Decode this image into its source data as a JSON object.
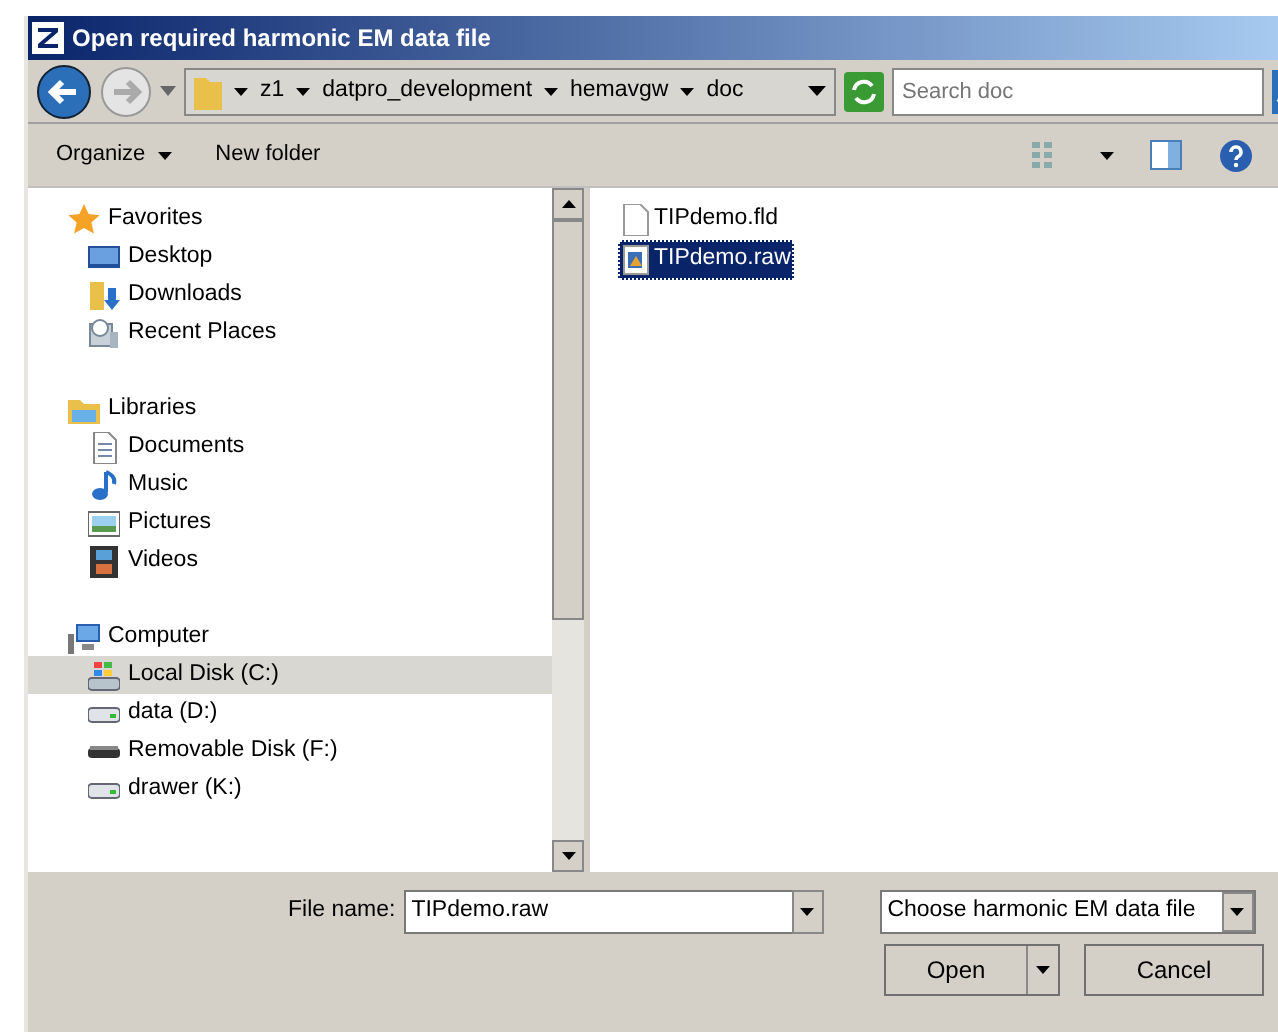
{
  "window": {
    "title": "Open required harmonic EM data file"
  },
  "address_bar": {
    "crumbs": [
      "z1",
      "datpro_development",
      "hemavgw",
      "doc"
    ]
  },
  "search": {
    "placeholder": "Search doc"
  },
  "toolbar": {
    "organize": "Organize",
    "new_folder": "New folder"
  },
  "navigation": [
    {
      "label": "Favorites",
      "kind": "star",
      "selected": false,
      "children": [
        {
          "label": "Desktop",
          "kind": "desktop",
          "selected": false
        },
        {
          "label": "Downloads",
          "kind": "download",
          "selected": false
        },
        {
          "label": "Recent Places",
          "kind": "recent",
          "selected": false
        }
      ]
    },
    {
      "label": "Libraries",
      "kind": "library",
      "selected": false,
      "children": [
        {
          "label": "Documents",
          "kind": "document",
          "selected": false
        },
        {
          "label": "Music",
          "kind": "music",
          "selected": false
        },
        {
          "label": "Pictures",
          "kind": "pictures",
          "selected": false
        },
        {
          "label": "Videos",
          "kind": "videos",
          "selected": false
        }
      ]
    },
    {
      "label": "Computer",
      "kind": "computer",
      "selected": false,
      "children": [
        {
          "label": "Local Disk (C:)",
          "kind": "systemdisk",
          "selected": true
        },
        {
          "label": "data (D:)",
          "kind": "disk",
          "selected": false
        },
        {
          "label": "Removable Disk (F:)",
          "kind": "removable",
          "selected": false
        },
        {
          "label": "drawer (K:)",
          "kind": "disk",
          "selected": false
        }
      ]
    }
  ],
  "files": [
    {
      "name": "TIPdemo.fld",
      "kind": "blank",
      "selected": false
    },
    {
      "name": "TIPdemo.raw",
      "kind": "data",
      "selected": true
    }
  ],
  "file_name": {
    "label": "File name:",
    "value": "TIPdemo.raw"
  },
  "file_type": {
    "value": "Choose harmonic EM data file"
  },
  "buttons": {
    "open": "Open",
    "cancel": "Cancel"
  }
}
